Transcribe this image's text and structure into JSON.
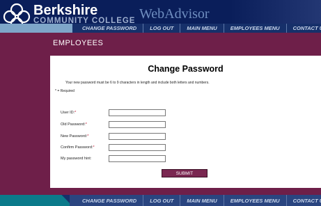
{
  "brand": {
    "name": "Berkshire",
    "subtitle": "COMMUNITY COLLEGE",
    "app": "WebAdvisor"
  },
  "nav": {
    "items": [
      "Change Password",
      "Log Out",
      "Main Menu",
      "Employees Menu",
      "Contact Us"
    ]
  },
  "section": {
    "title": "EMPLOYEES"
  },
  "page": {
    "heading": "Change Password",
    "instructions": "Your new password must be 6 to 9 characters in length and include both letters and numbers.",
    "required_note": "* = Required"
  },
  "form": {
    "fields": [
      {
        "label": "User ID:",
        "required": "*",
        "value": ""
      },
      {
        "label": "Old Password:",
        "required": "*",
        "value": ""
      },
      {
        "label": "New Password:",
        "required": "*",
        "value": ""
      },
      {
        "label": "Confirm Password:",
        "required": "*",
        "value": ""
      },
      {
        "label": "My password hint:",
        "required": "",
        "value": ""
      }
    ],
    "submit_label": "SUBMIT"
  },
  "colors": {
    "background": "#6e1f49",
    "header": "#0a1e5a",
    "nav": "#16306a",
    "submit": "#7a2751",
    "required_star": "#c0102b"
  }
}
